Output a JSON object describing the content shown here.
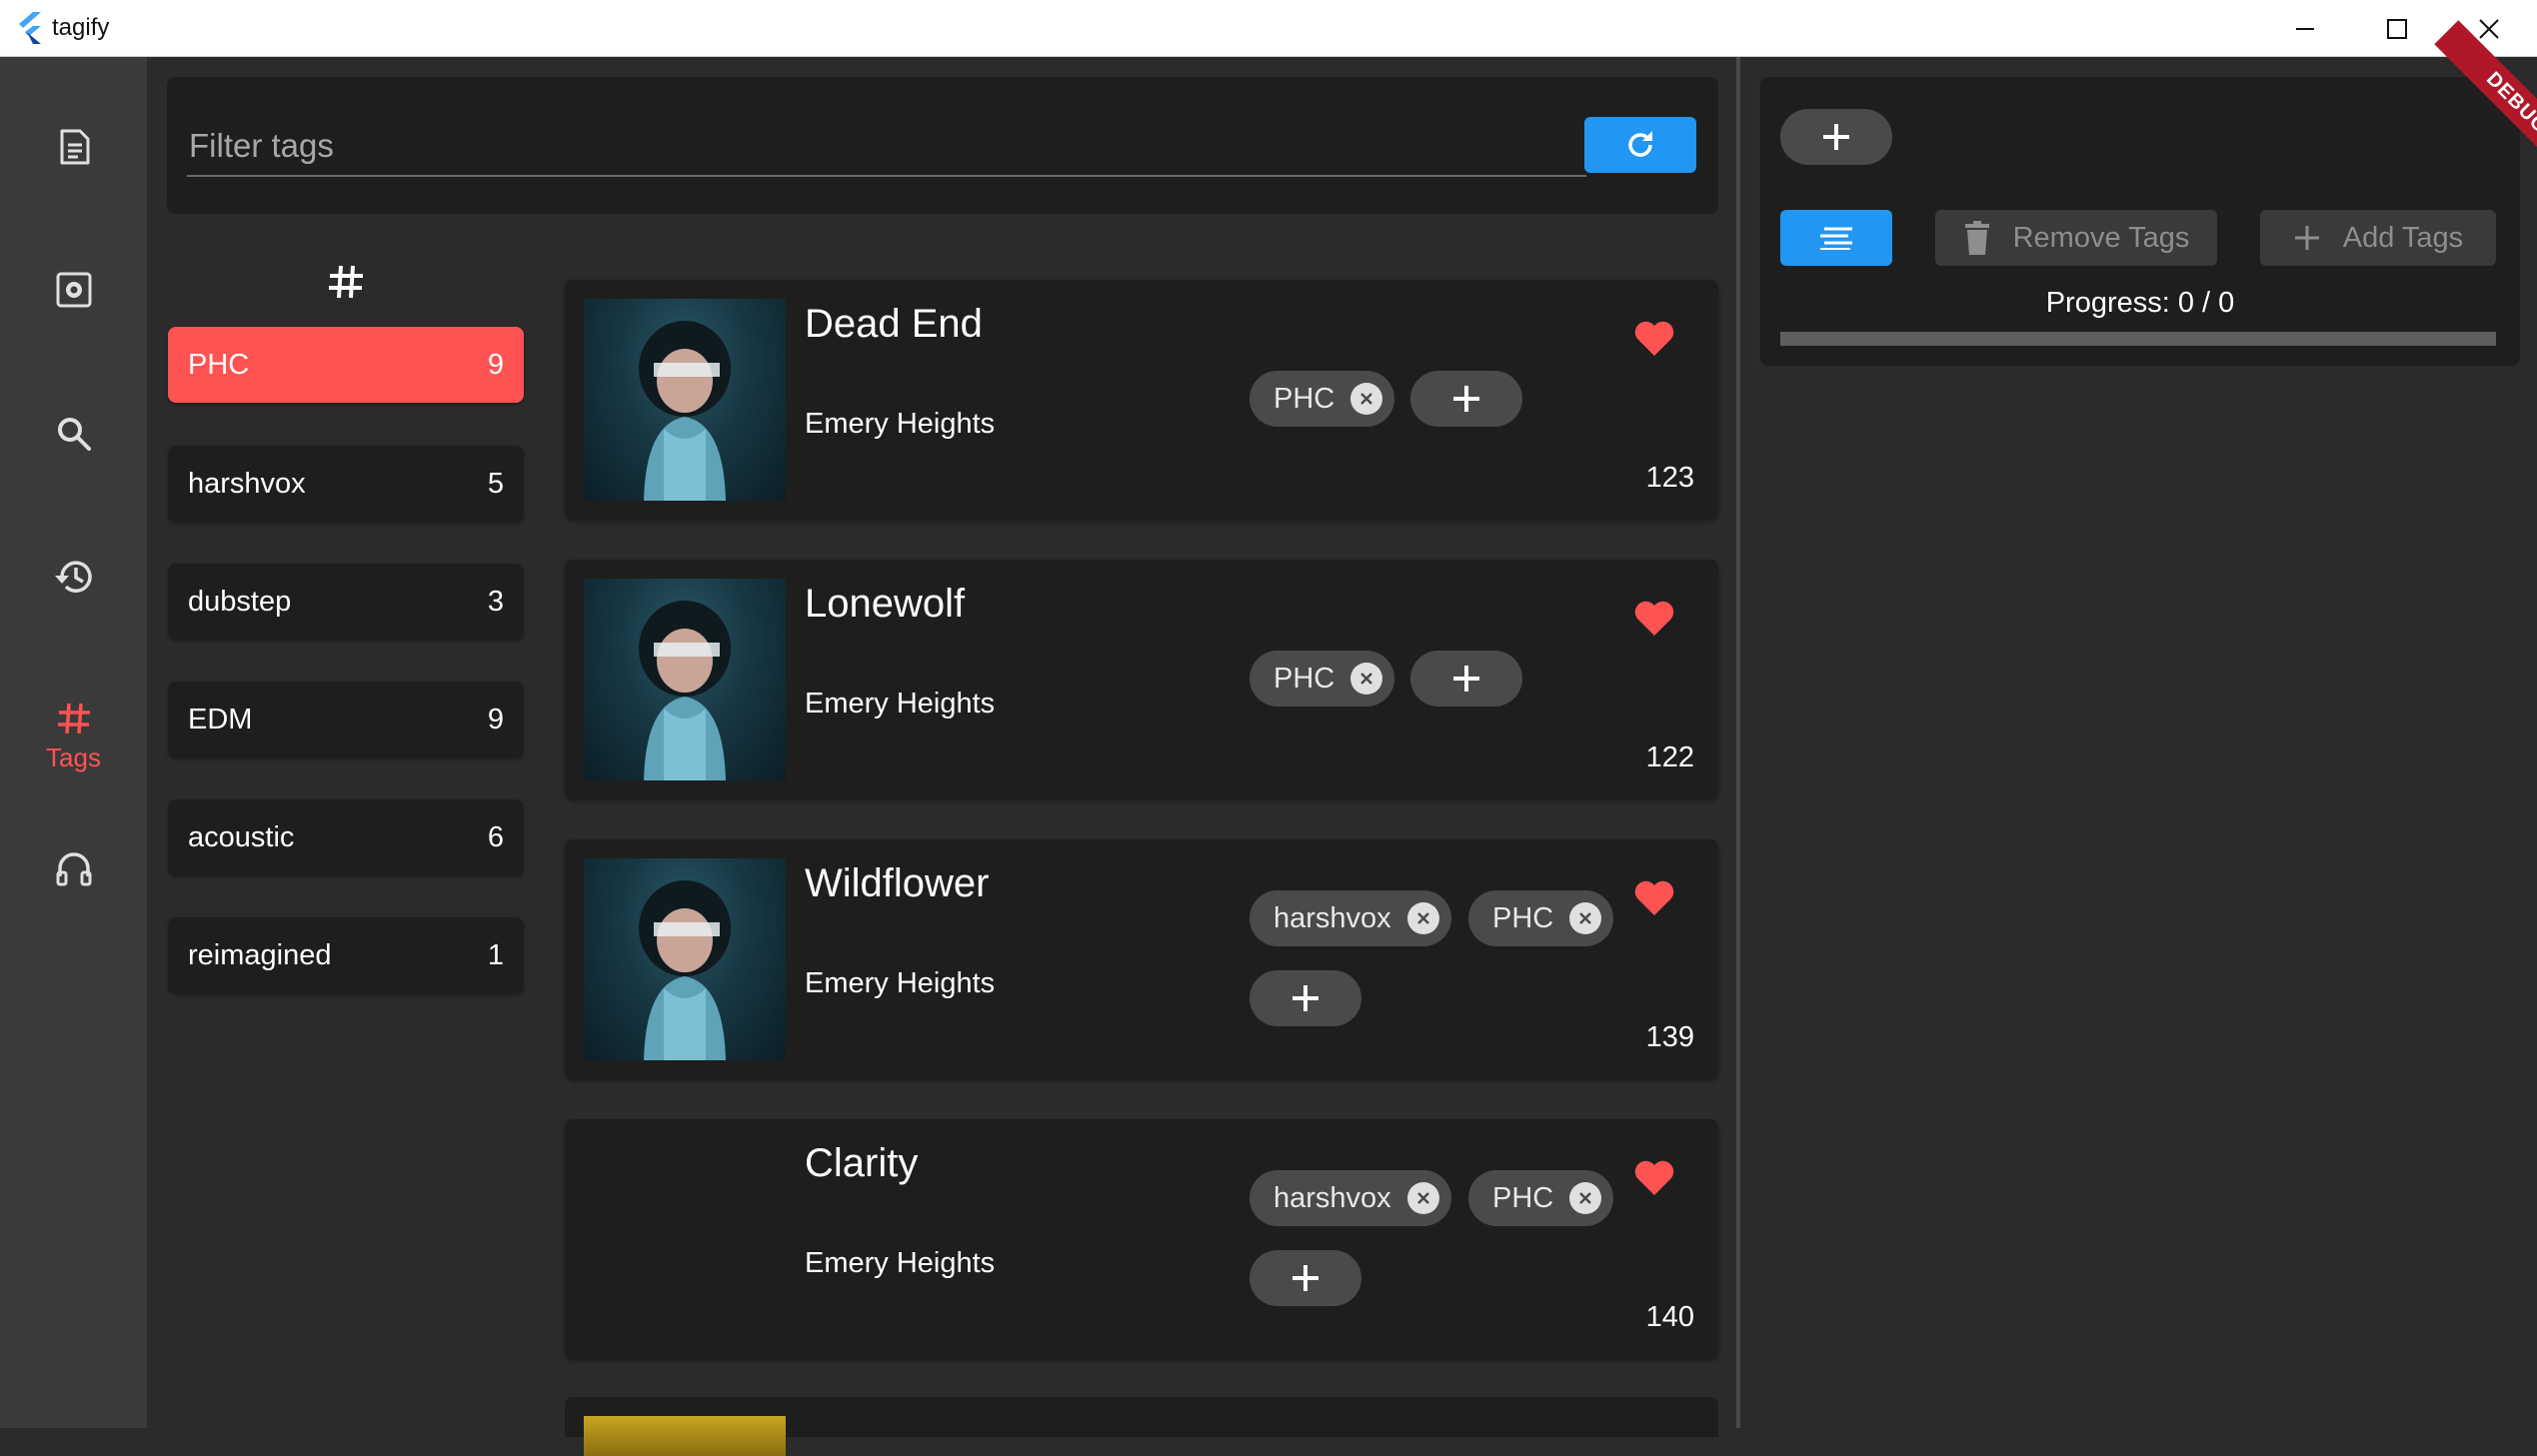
{
  "window": {
    "title": "tagify",
    "minimize_icon": "minimize-icon",
    "maximize_icon": "maximize-icon",
    "close_icon": "close-icon"
  },
  "nav": {
    "items": [
      {
        "icon": "document-icon",
        "label": ""
      },
      {
        "icon": "settings-icon",
        "label": ""
      },
      {
        "icon": "search-icon",
        "label": ""
      },
      {
        "icon": "history-icon",
        "label": ""
      },
      {
        "icon": "hash-icon",
        "label": "Tags",
        "active": true
      },
      {
        "icon": "headphones-icon",
        "label": ""
      }
    ],
    "active_color": "#ff5252"
  },
  "filter": {
    "placeholder": "Filter tags",
    "value": "",
    "refresh_icon": "refresh-icon"
  },
  "tags": [
    {
      "name": "PHC",
      "count": "9",
      "selected": true
    },
    {
      "name": "harshvox",
      "count": "5"
    },
    {
      "name": "dubstep",
      "count": "3"
    },
    {
      "name": "EDM",
      "count": "9"
    },
    {
      "name": "acoustic",
      "count": "6"
    },
    {
      "name": "reimagined",
      "count": "1"
    }
  ],
  "songs": [
    {
      "title": "Dead End",
      "artist": "Emery Heights",
      "tags": [
        "PHC"
      ],
      "plays": "123",
      "liked": true
    },
    {
      "title": "Lonewolf",
      "artist": "Emery Heights",
      "tags": [
        "PHC"
      ],
      "plays": "122",
      "liked": true
    },
    {
      "title": "Wildflower",
      "artist": "Emery Heights",
      "tags": [
        "harshvox",
        "PHC"
      ],
      "plays": "139",
      "liked": true
    },
    {
      "title": "Clarity",
      "artist": "Emery Heights",
      "tags": [
        "harshvox",
        "PHC"
      ],
      "plays": "140",
      "liked": true
    }
  ],
  "batch": {
    "remove_label": "Remove Tags",
    "add_label": "Add Tags",
    "progress_text": "Progress: 0 / 0",
    "progress_fraction": 0
  },
  "debug_banner": "DEBUG",
  "colors": {
    "accent": "#2196f3",
    "selected": "#ff5252",
    "heart": "#ff5252",
    "card": "#1e1e1e",
    "background": "#2b2b2b"
  }
}
